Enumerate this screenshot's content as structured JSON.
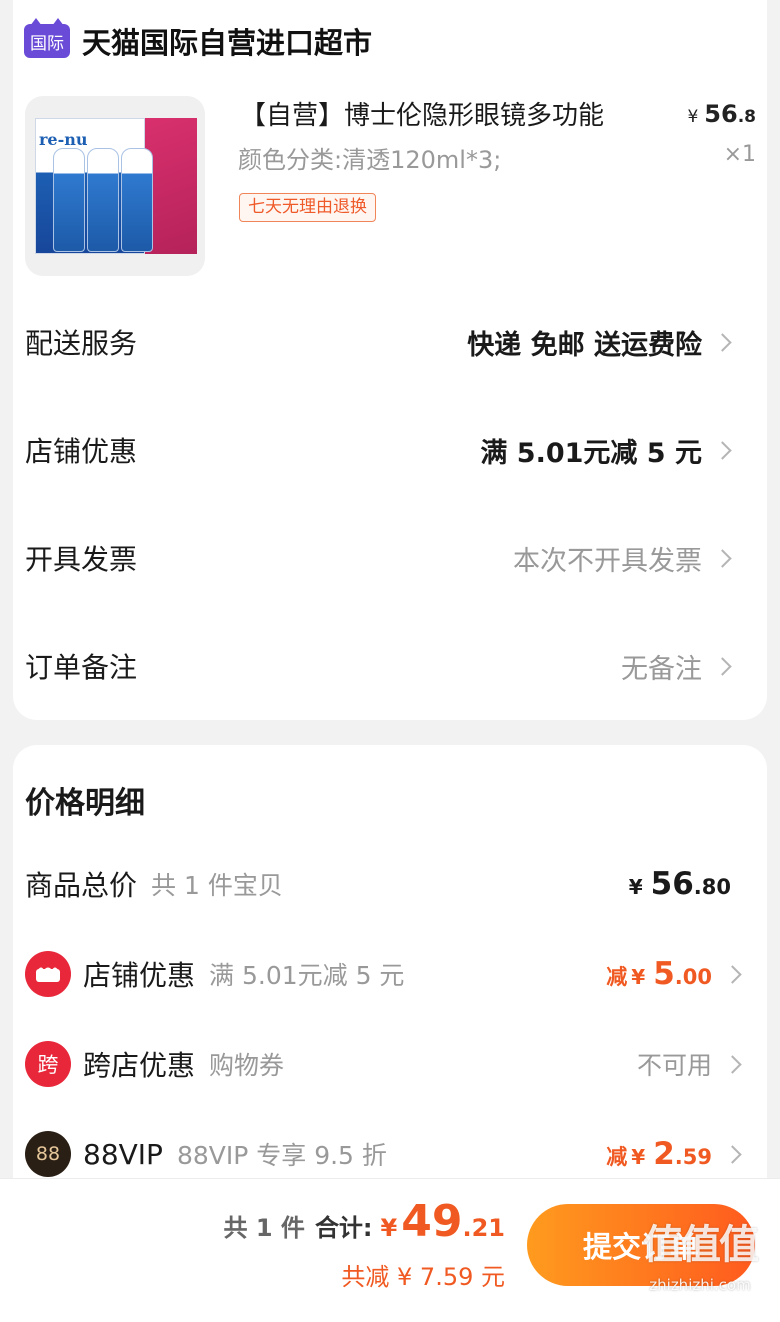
{
  "store": {
    "badge": "国际",
    "name": "天猫国际自营进口超市"
  },
  "product": {
    "image_text": "re-nu",
    "title": "【自营】博士伦隐形眼镜多功能",
    "sku": "颜色分类:清透120ml*3;",
    "tag": "七天无理由退换",
    "price_currency": "¥",
    "price_int": "56",
    "price_dec": ".8",
    "quantity": "×1"
  },
  "options": [
    {
      "label": "配送服务",
      "value": "快递 免邮 送运费险"
    },
    {
      "label": "店铺优惠",
      "value": "满 5.01元减 5 元"
    },
    {
      "label": "开具发票",
      "value": "本次不开具发票"
    },
    {
      "label": "订单备注",
      "value": "无备注"
    }
  ],
  "price_detail": {
    "title": "价格明细",
    "goods_total": {
      "label": "商品总价",
      "sub": "共 1 件宝贝",
      "currency": "¥",
      "int": "56",
      "dec": ".80"
    },
    "shop_discount": {
      "icon": "shop-coupon-icon",
      "label": "店铺优惠",
      "sub": "满 5.01元减 5 元",
      "prefix": "减",
      "currency": "¥",
      "int": "5",
      "dec": ".00"
    },
    "cross_store": {
      "icon_text": "跨",
      "label": "跨店优惠",
      "sub": "购物券",
      "value": "不可用"
    },
    "vip": {
      "icon_text": "88",
      "label": "88VIP",
      "sub": "88VIP 专享 9.5 折",
      "prefix": "减",
      "currency": "¥",
      "int": "2",
      "dec": ".59"
    }
  },
  "footer": {
    "count": "共 1 件",
    "total_label": "合计:",
    "currency": "¥",
    "total_int": "49",
    "total_dec": ".21",
    "saved": "共减 ¥ 7.59 元",
    "submit_label": "提交订单",
    "watermark": "值值值",
    "watermark_url": "zhizhizhi.com"
  },
  "colors": {
    "accent": "#f05a22",
    "store_badge": "#6a4bd8",
    "button_start": "#ff9b1e",
    "button_end": "#ff5a1e"
  }
}
